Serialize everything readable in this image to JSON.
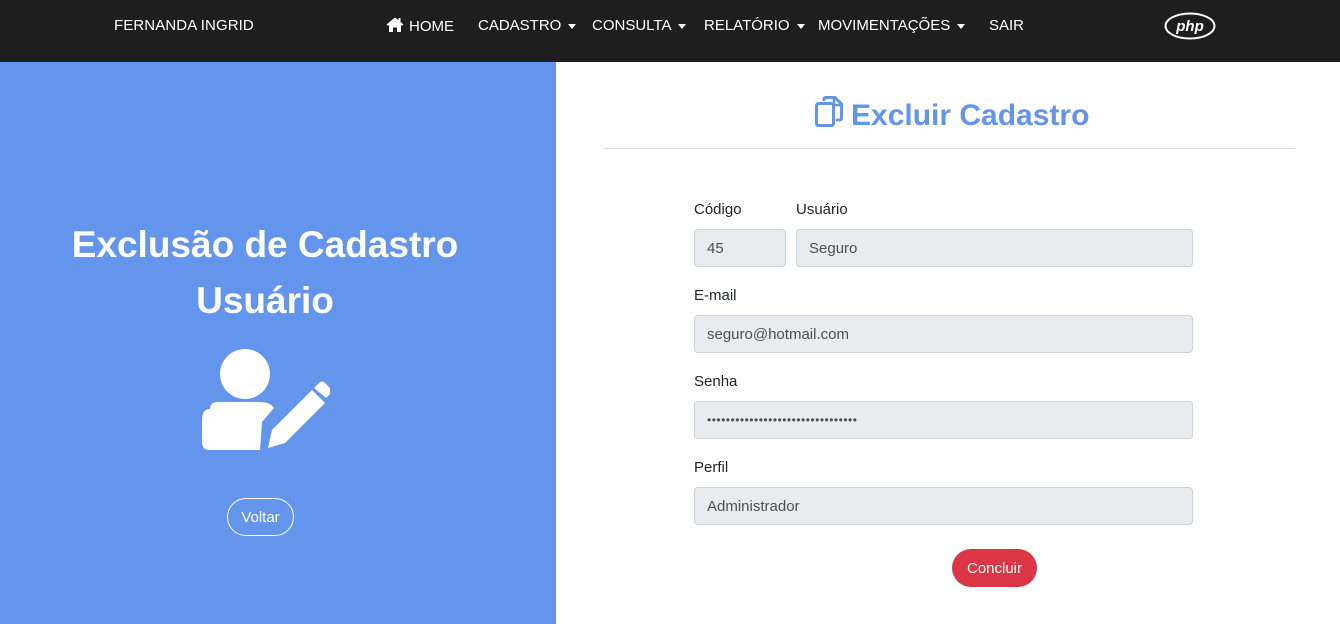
{
  "navbar": {
    "brand": "FERNANDA INGRID",
    "items": [
      {
        "label": "HOME",
        "icon": "home-icon",
        "dropdown": false
      },
      {
        "label": "CADASTRO",
        "dropdown": true
      },
      {
        "label": "CONSULTA",
        "dropdown": true
      },
      {
        "label": "RELATÓRIO",
        "dropdown": true
      },
      {
        "label": "MOVIMENTAÇÕES",
        "dropdown": true
      },
      {
        "label": "SAIR",
        "dropdown": false
      }
    ],
    "logo_text": "php"
  },
  "left_panel": {
    "title_line1": "Exclusão de Cadastro",
    "title_line2": "Usuário",
    "icon": "user-edit-icon",
    "back_button": "Voltar",
    "bg_color": "#6495ed"
  },
  "main": {
    "title": "Excluir Cadastro",
    "title_icon": "copy-icon",
    "form": {
      "codigo_label": "Código",
      "codigo_value": "45",
      "usuario_label": "Usuário",
      "usuario_value": "Seguro",
      "email_label": "E-mail",
      "email_value": "seguro@hotmail.com",
      "senha_label": "Senha",
      "senha_value": "••••••••••••••••••••••••••••••••",
      "perfil_label": "Perfil",
      "perfil_value": "Administrador"
    },
    "submit_button": "Concluir",
    "submit_color": "#dc3545"
  }
}
